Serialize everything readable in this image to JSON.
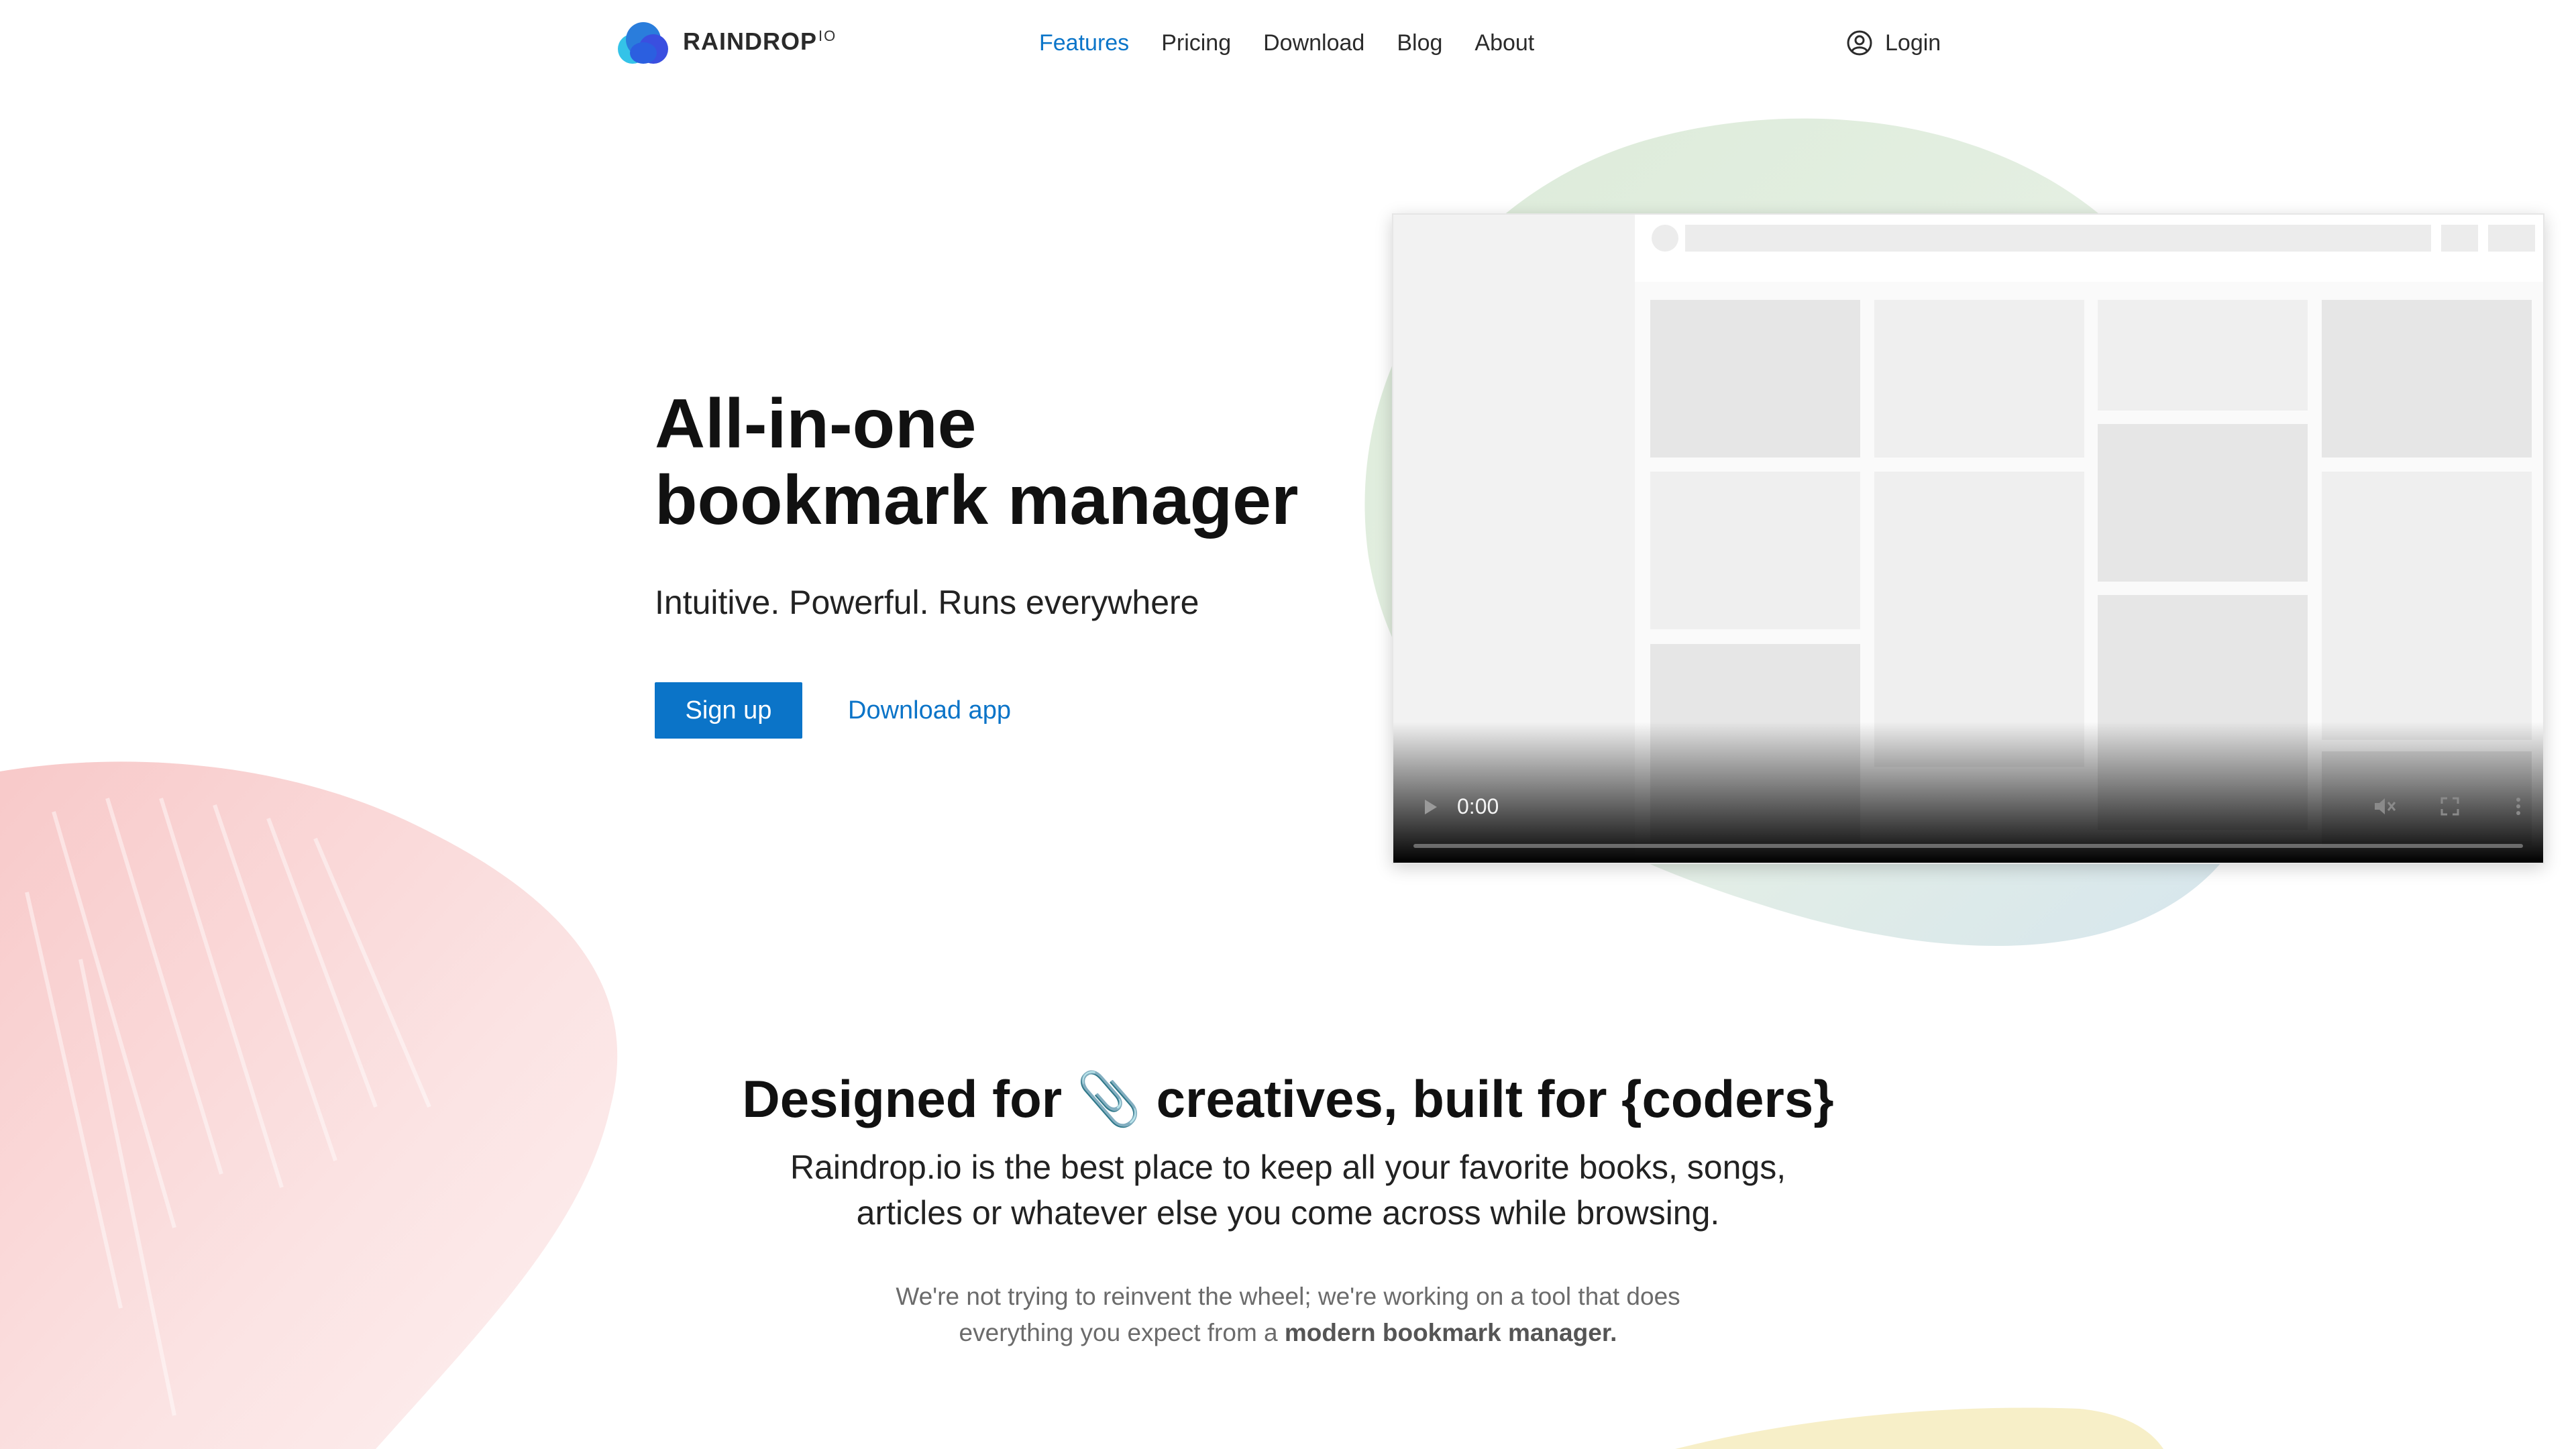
{
  "brand": {
    "name": "RAINDROP",
    "suffix": "IO",
    "colors": {
      "blue": "#0b74c8",
      "logo_dark": "#2a5bd8",
      "logo_light": "#34c3e8"
    }
  },
  "nav": {
    "items": [
      {
        "label": "Features",
        "active": true
      },
      {
        "label": "Pricing",
        "active": false
      },
      {
        "label": "Download",
        "active": false
      },
      {
        "label": "Blog",
        "active": false
      },
      {
        "label": "About",
        "active": false
      }
    ],
    "login_label": "Login",
    "login_icon": "user-circle-icon"
  },
  "hero": {
    "title_line1": "All-in-one",
    "title_line2": "bookmark manager",
    "subtitle": "Intuitive. Powerful. Runs everywhere",
    "signup_label": "Sign up",
    "download_label": "Download app"
  },
  "video": {
    "time": "0:00",
    "progress": 0,
    "icons": [
      "play-icon",
      "muted-volume-icon",
      "fullscreen-icon",
      "more-options-icon"
    ]
  },
  "section2": {
    "title_part1": "Designed for",
    "title_icon": "📎",
    "title_part2": "creatives, built for {coders}",
    "lead_line1": "Raindrop.io is the best place to keep all your favorite books, songs,",
    "lead_line2": "articles or whatever else you come across while browsing.",
    "note_line1": "We're not trying to reinvent the wheel; we're working on a tool that does",
    "note_line2_prefix": "everything you expect from a ",
    "note_line2_bold": "modern bookmark manager."
  }
}
